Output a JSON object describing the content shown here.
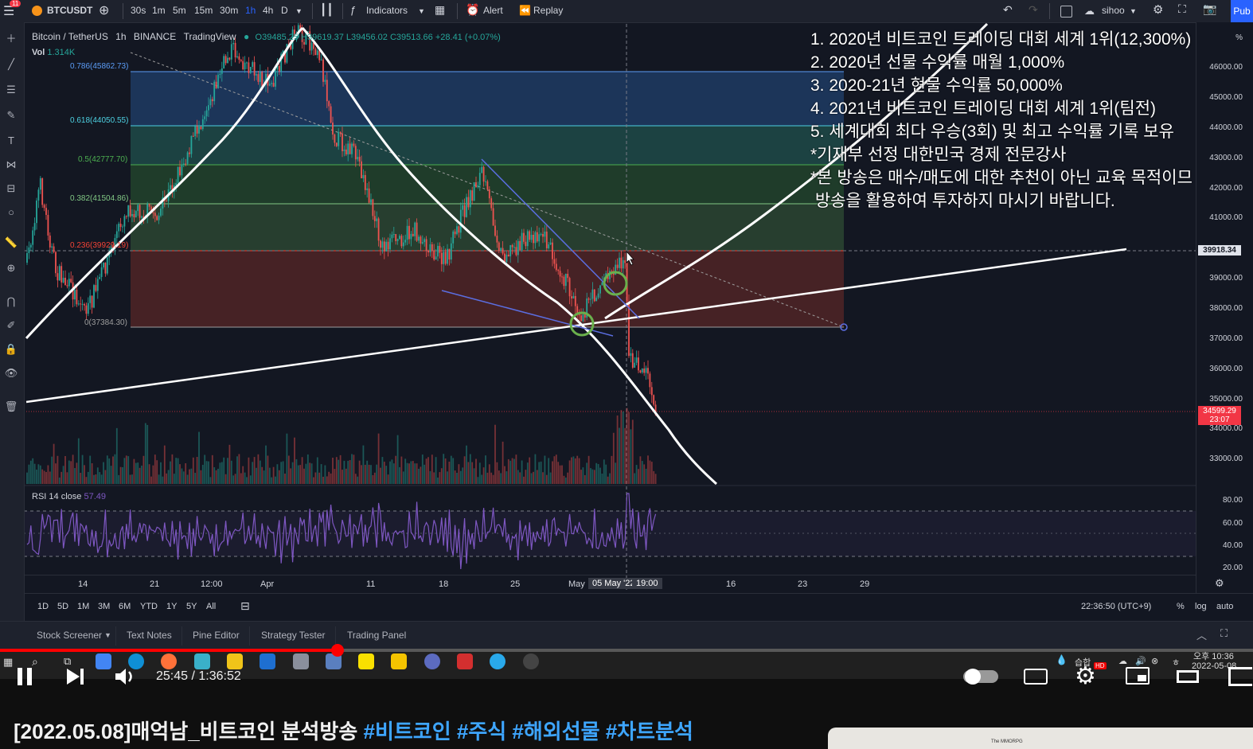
{
  "toolbar": {
    "badge": "11",
    "symbol": "BTCUSDT",
    "intervals": [
      "30s",
      "1m",
      "5m",
      "15m",
      "30m",
      "1h",
      "4h",
      "D"
    ],
    "active_interval": "1h",
    "indicators": "Indicators",
    "alert": "Alert",
    "replay": "Replay",
    "user": "sihoo",
    "publish": "Pub"
  },
  "legend": {
    "pair": "Bitcoin / TetherUS",
    "interval": "1h",
    "exchange": "BINANCE",
    "source": "TradingView",
    "ohlc": "O39485.25 H39619.37 L39456.02 C39513.66 +28.41 (+0.07%)",
    "vol_label": "Vol",
    "vol_value": "1.314K"
  },
  "fib_levels": [
    {
      "label": "0.786(45862.73)",
      "color": "#5b9cf6"
    },
    {
      "label": "0.618(44050.55)",
      "color": "#4dd0e1"
    },
    {
      "label": "0.5(42777.70)",
      "color": "#4caf50"
    },
    {
      "label": "0.382(41504.86)",
      "color": "#81c784"
    },
    {
      "label": "0.236(39929.19)",
      "color": "#f44336"
    },
    {
      "label": "0(37384.30)",
      "color": "#9e9e9e"
    }
  ],
  "overlay_text": [
    "1. 2020년 비트코인 트레이딩 대회 세계 1위(12,300%)",
    "2. 2020년 선물 수익률 매월 1,000%",
    "3. 2020-21년 현물 수익률 50,000%",
    "4. 2021년 비트코인 트레이딩 대회 세계 1위(팀전)",
    "5. 세계대회 최다 우승(3회) 및 최고 수익률 기록 보유",
    "*기재부 선정 대한민국 경제 전문강사",
    "*본 방송은 매수/매도에 대한 추천이 아닌 교육 목적이므",
    " 방송을 활용하여 투자하지 마시기 바랍니다."
  ],
  "price_axis": {
    "labels": [
      "%",
      "46000.00",
      "45000.00",
      "44000.00",
      "43000.00",
      "42000.00",
      "41000.00",
      "39000.00",
      "38000.00",
      "37000.00",
      "36000.00",
      "35000.00",
      "34000.00",
      "33000.00"
    ],
    "crosshair_price": "39918.34",
    "last_price": "34599.29",
    "countdown": "23:07",
    "rsi_labels": [
      "80.00",
      "60.00",
      "40.00",
      "20.00"
    ]
  },
  "rsi": {
    "label": "RSI",
    "params": "14 close",
    "value": "57.49"
  },
  "time_axis": {
    "labels": [
      "14",
      "21",
      "12:00",
      "Apr",
      "11",
      "18",
      "25",
      "May",
      "16",
      "23",
      "29"
    ],
    "crosshair_date": "05 May '22",
    "crosshair_time": "19:00"
  },
  "ranges": [
    "1D",
    "5D",
    "1M",
    "3M",
    "6M",
    "YTD",
    "1Y",
    "5Y",
    "All"
  ],
  "clock_tz": "22:36:50 (UTC+9)",
  "scale_opts": [
    "%",
    "log",
    "auto"
  ],
  "bottom_tabs": [
    "Stock Screener",
    "Text Notes",
    "Pine Editor",
    "Strategy Tester",
    "Trading Panel"
  ],
  "taskbar": {
    "ime": "습합",
    "hd": "HD",
    "time": "오후 10:36",
    "date": "2022-05-08"
  },
  "player": {
    "time": "25:45 / 1:36:52",
    "progress": 0.265
  },
  "video_title": {
    "main": "[2022.05.08]매억남_비트코인 분석방송",
    "tags": [
      "#비트코인",
      "#주식",
      "#해외선물",
      "#차트분석"
    ]
  },
  "thumbnail_text": "The MMORPG"
}
